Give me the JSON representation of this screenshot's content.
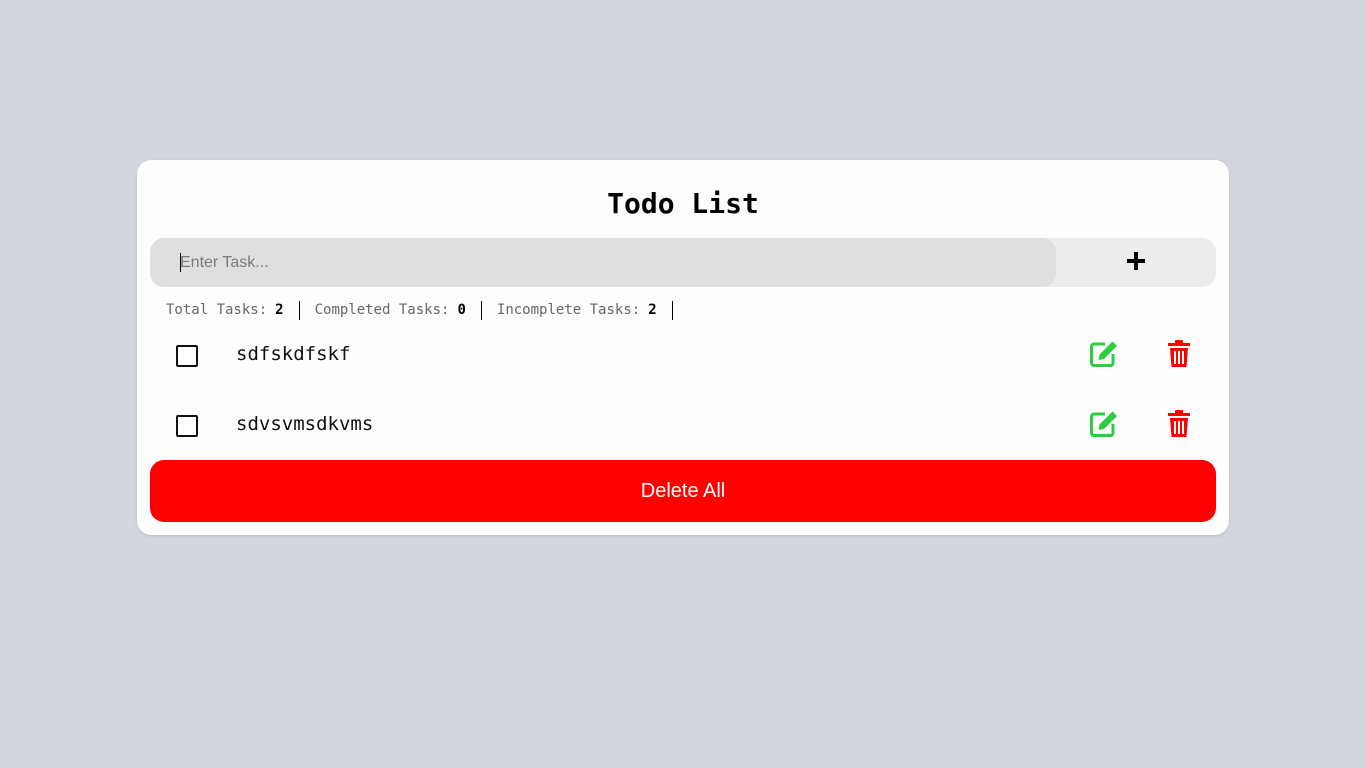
{
  "app": {
    "title": "Todo List"
  },
  "input": {
    "placeholder": "Enter Task...",
    "value": "",
    "add_icon": "plus-icon"
  },
  "stats": {
    "total_label": "Total Tasks:",
    "total_value": "2",
    "completed_label": "Completed Tasks:",
    "completed_value": "0",
    "incomplete_label": "Incomplete Tasks:",
    "incomplete_value": "2"
  },
  "tasks": [
    {
      "text": "sdfskdfskf",
      "completed": false,
      "edit_icon": "edit-icon",
      "delete_icon": "trash-icon"
    },
    {
      "text": "sdvsvmsdkvms",
      "completed": false,
      "edit_icon": "edit-icon",
      "delete_icon": "trash-icon"
    }
  ],
  "actions": {
    "delete_all_label": "Delete All"
  },
  "colors": {
    "background": "#d4d6de",
    "card": "#fdfdfd",
    "danger": "#ff0000",
    "edit": "#2ecc40"
  }
}
